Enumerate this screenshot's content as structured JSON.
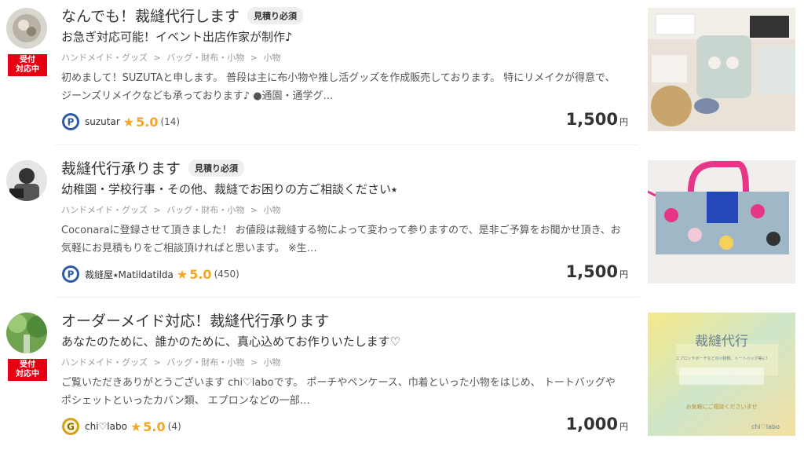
{
  "listings": [
    {
      "title": "なんでも！裁縫代行します",
      "quote_tag": "見積り必須",
      "subtitle": "お急ぎ対応可能！イベント出店作家が制作♪",
      "breadcrumb": [
        "ハンドメイド・グッズ",
        ">",
        "バッグ・財布・小物",
        ">",
        "小物"
      ],
      "description": "初めまして！SUZUTAと申します。 普段は主に布小物や推し活グッズを作成販売しております。 特にリメイクが得意で、ジーンズリメイクなども承っております♪ ●通園・通学グ…",
      "seller": "suzutar",
      "rank_letter": "P",
      "rank_icon": "platinum-rank-icon",
      "rating": "5.0",
      "reviews": "(14)",
      "price": "1,500",
      "price_unit": "円",
      "badge": "受付\n対応中"
    },
    {
      "title": "裁縫代行承ります",
      "quote_tag": "見積り必須",
      "subtitle": "幼稚園・学校行事・その他、裁縫でお困りの方ご相談ください⭑",
      "breadcrumb": [
        "ハンドメイド・グッズ",
        ">",
        "バッグ・財布・小物",
        ">",
        "小物"
      ],
      "description": "Coconaraに登録させて頂きました！ お値段は裁縫する物によって変わって参りますので、是非ご予算をお聞かせ頂き、お気軽にお見積もりをご相談頂ければと思います。 ※生…",
      "seller": "裁縫屋⭑Matildatilda",
      "rank_letter": "P",
      "rank_icon": "platinum-rank-icon",
      "rating": "5.0",
      "reviews": "(450)",
      "price": "1,500",
      "price_unit": "円"
    },
    {
      "title": "オーダーメイド対応！裁縫代行承ります",
      "subtitle": "あなたのために、誰かのために、真心込めてお作りいたします♡",
      "breadcrumb": [
        "ハンドメイド・グッズ",
        ">",
        "バッグ・財布・小物",
        ">",
        "小物"
      ],
      "description": "ご覧いただきありがとうございます chi♡laboです。 ポーチやペンケース、巾着といった小物をはじめ、 トートバッグやポシェットといったカバン類、 エプロンなどの一部…",
      "seller": "chi♡labo",
      "rank_letter": "G",
      "rank_icon": "gold-rank-icon",
      "rating": "5.0",
      "reviews": "(4)",
      "price": "1,000",
      "price_unit": "円",
      "badge": "受付\n対応中",
      "thumb_text": {
        "main": "裁縫代行",
        "sub": "エプロンやポーチなどの小物類、トートバッグ等に!",
        "footer": "お気軽にご相談くださいませ",
        "brand": "chi♡labo"
      }
    }
  ],
  "colors": {
    "badge": "#e60012",
    "star": "#f5a623",
    "platinum": "#2e5aa8",
    "gold": "#d4a017"
  }
}
